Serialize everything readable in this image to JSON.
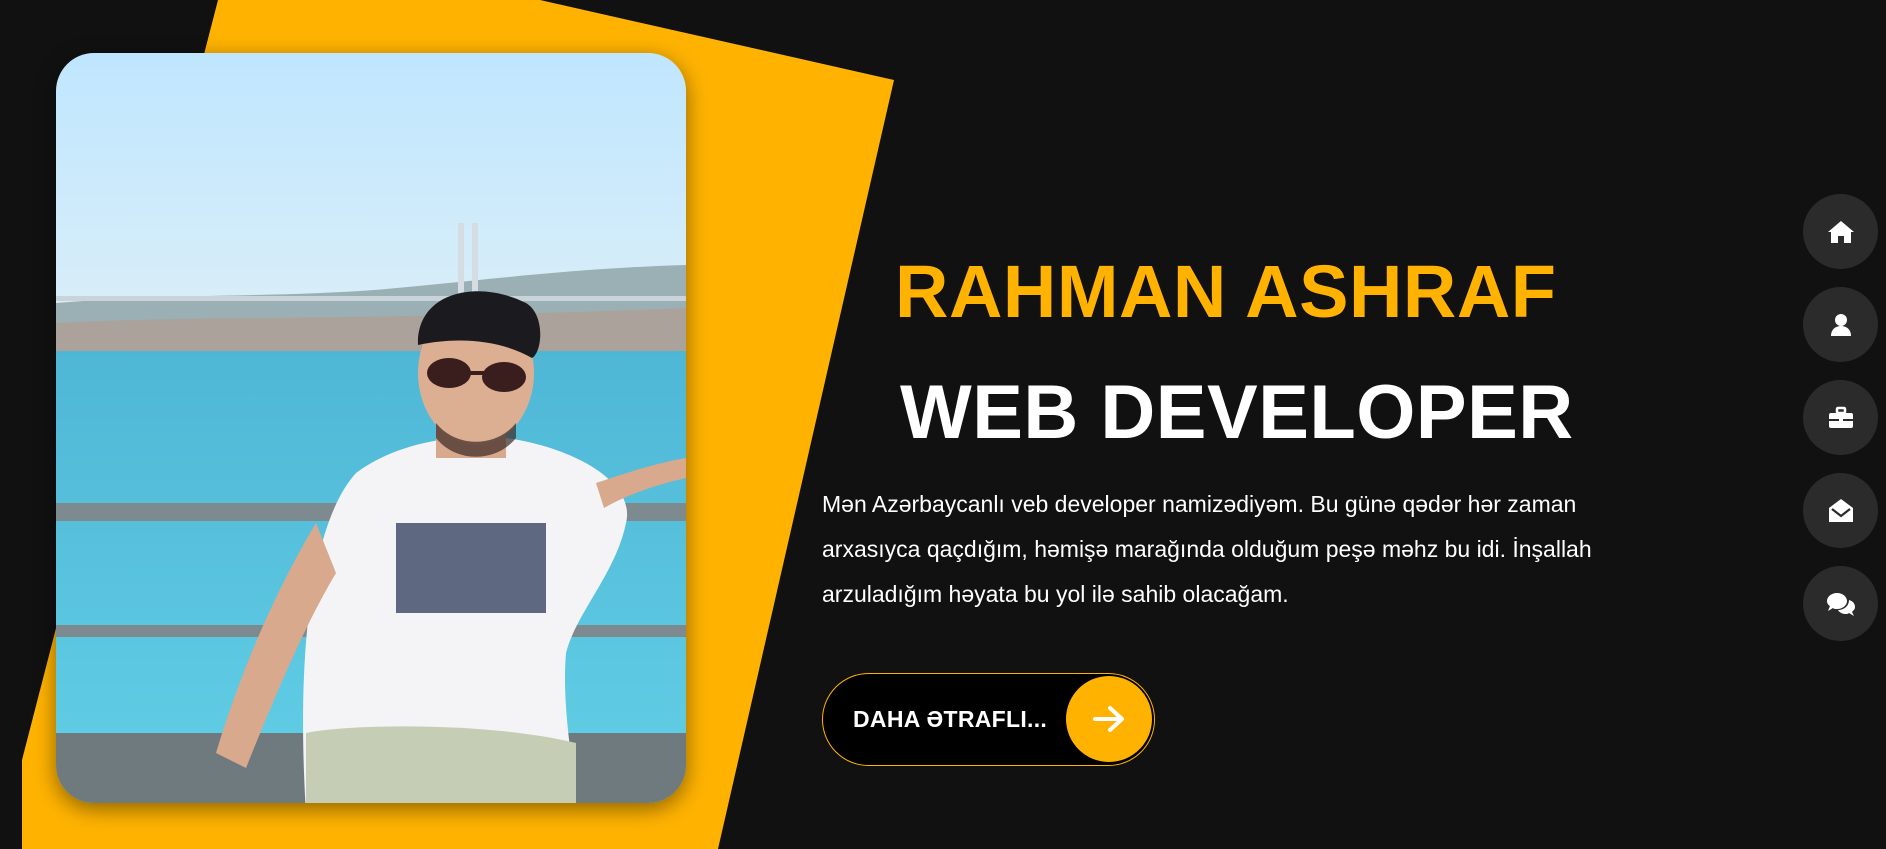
{
  "hero": {
    "name": "RAHMAN ASHRAF",
    "role": "WEB DEVELOPER",
    "bio": "Mən Azərbaycanlı veb developer namizədiyəm. Bu günə qədər hər zaman arxasıyca qaçdığım, həmişə marağında olduğum peşə məhz bu idi. İnşallah arzuladığım həyata bu yol ilə sahib olacağam.",
    "cta_label": "DAHA ƏTRAFLI...",
    "cta_icon": "arrow-right-icon"
  },
  "side_nav": [
    {
      "name": "home",
      "icon": "home-icon"
    },
    {
      "name": "about",
      "icon": "user-icon"
    },
    {
      "name": "portfolio",
      "icon": "briefcase-icon"
    },
    {
      "name": "contact",
      "icon": "envelope-open-icon"
    },
    {
      "name": "blog",
      "icon": "comments-icon"
    }
  ],
  "colors": {
    "accent": "#ffb300",
    "background": "#111111",
    "nav_button": "#2b2b2b"
  }
}
